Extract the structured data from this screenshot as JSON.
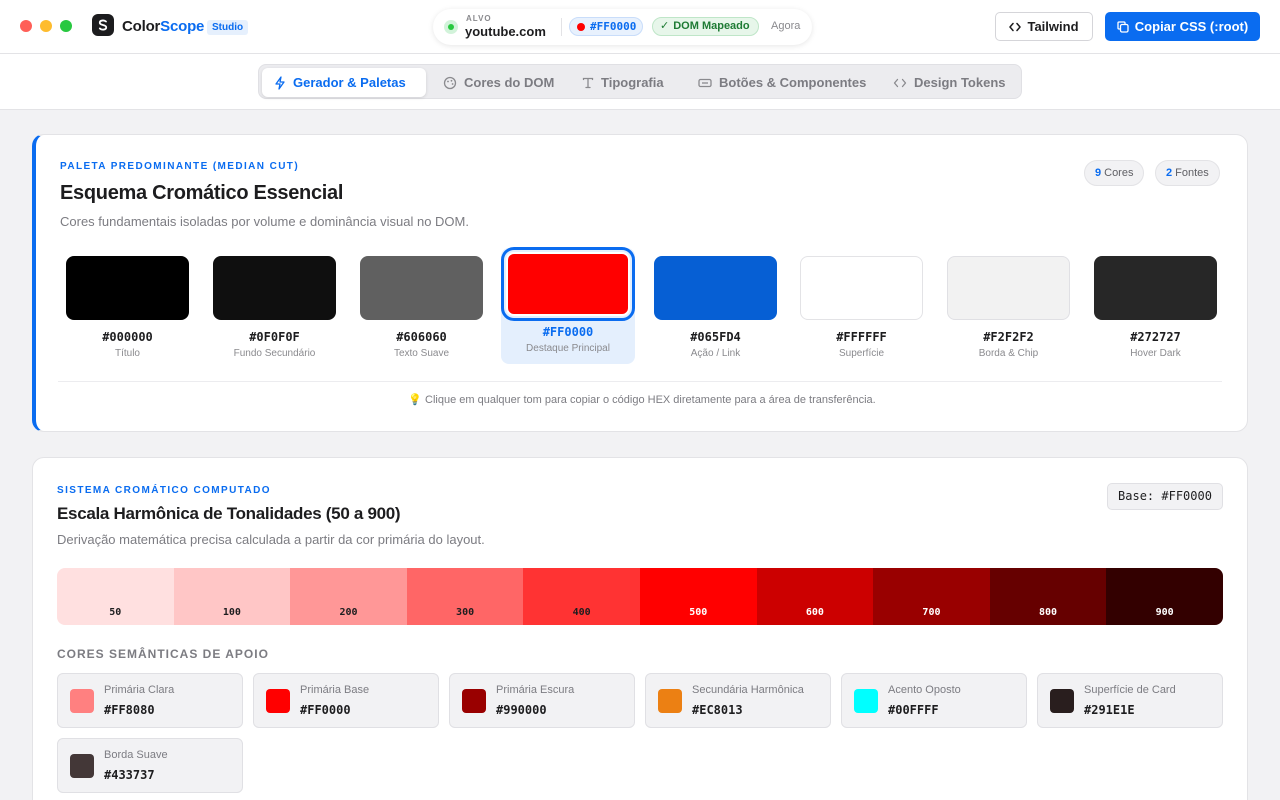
{
  "window": {
    "brand_part1": "Color",
    "brand_part2": "Scope",
    "badge": "Studio"
  },
  "target": {
    "label": "ALVO",
    "host": "youtube.com",
    "color_chip": "#FF0000",
    "status": "DOM Mapeado",
    "time": "Agora"
  },
  "toolbar": {
    "tailwind_label": "Tailwind",
    "copy_label": "Copiar CSS (:root)"
  },
  "tabs": [
    {
      "label": "Gerador & Paletas",
      "icon": "bolt-icon",
      "active": true
    },
    {
      "label": "Cores do DOM",
      "icon": "palette-icon",
      "active": false
    },
    {
      "label": "Tipografia",
      "icon": "type-icon",
      "active": false
    },
    {
      "label": "Botões & Componentes",
      "icon": "button-icon",
      "active": false
    },
    {
      "label": "Design Tokens",
      "icon": "code-icon",
      "active": false
    }
  ],
  "palette": {
    "eyebrow": "PALETA PREDOMINANTE (MEDIAN CUT)",
    "title": "Esquema Cromático Essencial",
    "subtitle": "Cores fundamentais isoladas por volume e dominância visual no DOM.",
    "colors_count": "9",
    "colors_label": "Cores",
    "fonts_count": "2",
    "fonts_label": "Fontes",
    "swatches": [
      {
        "hex": "#000000",
        "name": "Título",
        "color": "#000000"
      },
      {
        "hex": "#0F0F0F",
        "name": "Fundo Secundário",
        "color": "#0F0F0F"
      },
      {
        "hex": "#606060",
        "name": "Texto Suave",
        "color": "#606060"
      },
      {
        "hex": "#FF0000",
        "name": "Destaque Principal",
        "color": "#FF0000",
        "selected": true
      },
      {
        "hex": "#065FD4",
        "name": "Ação / Link",
        "color": "#065FD4"
      },
      {
        "hex": "#FFFFFF",
        "name": "Superfície",
        "color": "#FFFFFF"
      },
      {
        "hex": "#F2F2F2",
        "name": "Borda & Chip",
        "color": "#F2F2F2"
      },
      {
        "hex": "#272727",
        "name": "Hover Dark",
        "color": "#272727"
      }
    ],
    "hint": "💡 Clique em qualquer tom para copiar o código HEX diretamente para a área de transferência."
  },
  "scale": {
    "eyebrow": "SISTEMA CROMÁTICO COMPUTADO",
    "title": "Escala Harmônica de Tonalidades (50 a 900)",
    "subtitle": "Derivação matemática precisa calculada a partir da cor primária do layout.",
    "base_label": "Base: #FF0000",
    "steps": [
      {
        "label": "50",
        "color": "#FFE0E0",
        "text": "#1d1d1f"
      },
      {
        "label": "100",
        "color": "#FFC6C6",
        "text": "#1d1d1f"
      },
      {
        "label": "200",
        "color": "#FF9797",
        "text": "#1d1d1f"
      },
      {
        "label": "300",
        "color": "#FF6666",
        "text": "#1d1d1f"
      },
      {
        "label": "400",
        "color": "#FF3333",
        "text": "#1d1d1f"
      },
      {
        "label": "500",
        "color": "#FF0000",
        "text": "#ffffff"
      },
      {
        "label": "600",
        "color": "#CC0000",
        "text": "#ffffff"
      },
      {
        "label": "700",
        "color": "#990000",
        "text": "#ffffff"
      },
      {
        "label": "800",
        "color": "#660000",
        "text": "#ffffff"
      },
      {
        "label": "900",
        "color": "#330000",
        "text": "#ffffff"
      }
    ],
    "semantic_title": "CORES SEMÂNTICAS DE APOIO",
    "semantic": [
      {
        "name": "Primária Clara",
        "hex": "#FF8080",
        "color": "#FF8080"
      },
      {
        "name": "Primária Base",
        "hex": "#FF0000",
        "color": "#FF0000"
      },
      {
        "name": "Primária Escura",
        "hex": "#990000",
        "color": "#990000"
      },
      {
        "name": "Secundária Harmônica",
        "hex": "#EC8013",
        "color": "#EC8013"
      },
      {
        "name": "Acento Oposto",
        "hex": "#00FFFF",
        "color": "#00FFFF"
      },
      {
        "name": "Superfície de Card",
        "hex": "#291E1E",
        "color": "#291E1E"
      },
      {
        "name": "Borda Suave",
        "hex": "#433737",
        "color": "#433737"
      }
    ]
  }
}
